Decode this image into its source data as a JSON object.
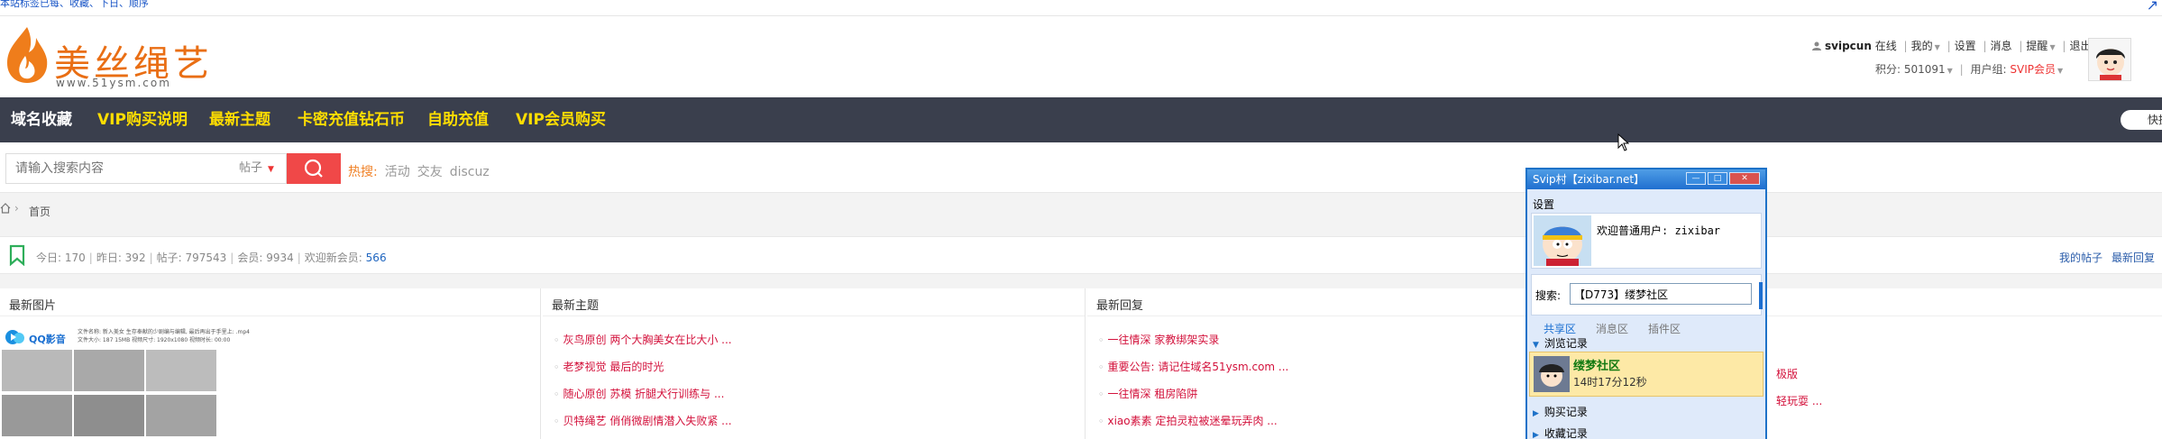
{
  "topbar": {
    "tip": "本站标签已每、收藏、下日、顺序"
  },
  "logo": {
    "text": "美丝绳艺",
    "url": "www.51ysm.com"
  },
  "user": {
    "name": "svipcun",
    "status": "在线",
    "links": [
      "我的",
      "设置",
      "消息",
      "提醒",
      "退出"
    ],
    "points_label": "积分: 501091",
    "group_label": "用户组:",
    "group_value": "SVIP会员"
  },
  "nav": {
    "items": [
      "域名收藏",
      "VIP购买说明",
      "最新主题",
      "卡密充值钻石币",
      "自助充值",
      "VIP会员购买"
    ],
    "quick": "快捷"
  },
  "search": {
    "placeholder": "请输入搜索内容",
    "type": "帖子",
    "hot_label": "热搜:",
    "hot_words": [
      "活动",
      "交友",
      "discuz"
    ]
  },
  "breadcrumb": {
    "current": "首页"
  },
  "stats": {
    "today": "今日: 170",
    "yesterday": "昨日: 392",
    "posts": "帖子: 797543",
    "members": "会员: 9934",
    "welcome_label": "欢迎新会员:",
    "newest": "566",
    "my_posts": "我的帖子",
    "latest_reply": "最新回复"
  },
  "columns": {
    "pics_title": "最新图片",
    "pics_brand": "QQ影音",
    "pics_meta": [
      "文件名称: 新入美女 生存奉献的少剧编与编辑, 最后再出于手里上: .mp4",
      "文件大小: 187 15MB      视频尺寸: 1920x1080      视频时长: 00:00"
    ],
    "topics_title": "最新主题",
    "topics": [
      "灰鸟原创 两个大胸美女在比大小 ...",
      "老梦视觉 最后的时光",
      "随心原创 苏模 折腿犬行训练与 ...",
      "贝特绳艺 俏俏微剧情潜入失败紧 ..."
    ],
    "replies_title": "最新回复",
    "replies": [
      "一往情深 家教绑架实录",
      "重要公告: 请记住域名51ysm.com ...",
      "一往情深 租房陷阱",
      "xiao素素 定拍灵粒被迷晕玩弄肉 ..."
    ],
    "fourth_partial": [
      "极版",
      "轻玩耍 ..."
    ]
  },
  "window": {
    "title": "Svip村【zixibar.net】",
    "menu": "设置",
    "welcome": "欢迎普通用户: zixibar",
    "search_label": "搜索:",
    "search_value": "【D773】缕梦社区",
    "tabs": [
      "共享区",
      "消息区",
      "插件区"
    ],
    "group_browse": "浏览记录",
    "history_name": "缕梦社区",
    "history_time": "14时17分12秒",
    "group_buy": "购买记录",
    "group_fav": "收藏记录"
  }
}
